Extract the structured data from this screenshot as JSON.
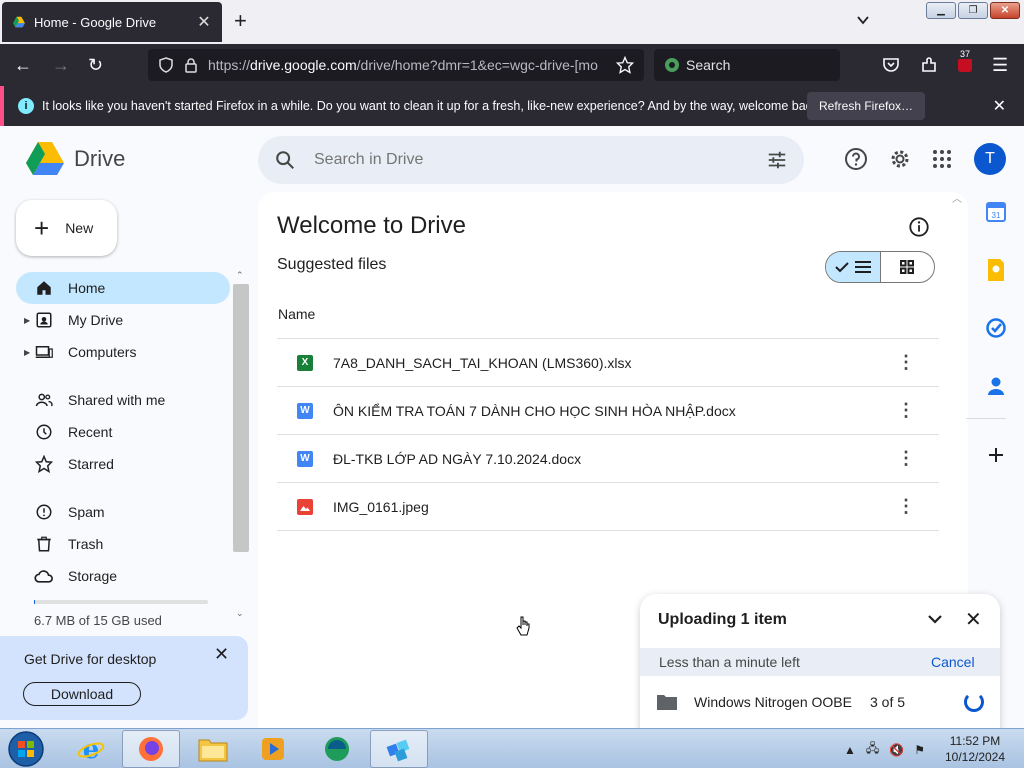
{
  "browser": {
    "tab_title": "Home - Google Drive",
    "url_host": "drive.google.com",
    "url_prefix": "https://",
    "url_path": "/drive/home?dmr=1&ec=wgc-drive-[mo",
    "search_placeholder": "Search",
    "extension_badge": "37",
    "notice_text": "It looks like you haven't started Firefox in a while. Do you want to clean it up for a fresh, like-new experience? And by the way, welcome back!",
    "refresh_label": "Refresh Firefox…"
  },
  "drive": {
    "app_name": "Drive",
    "search_placeholder": "Search in Drive",
    "avatar_letter": "T",
    "new_label": "New",
    "nav": [
      {
        "label": "Home",
        "icon": "home-icon"
      },
      {
        "label": "My Drive",
        "icon": "my-drive-icon"
      },
      {
        "label": "Computers",
        "icon": "computers-icon"
      },
      {
        "label": "Shared with me",
        "icon": "shared-icon"
      },
      {
        "label": "Recent",
        "icon": "recent-icon"
      },
      {
        "label": "Starred",
        "icon": "star-icon"
      },
      {
        "label": "Spam",
        "icon": "spam-icon"
      },
      {
        "label": "Trash",
        "icon": "trash-icon"
      },
      {
        "label": "Storage",
        "icon": "cloud-icon"
      }
    ],
    "storage_used_text": "6.7 MB of 15 GB used",
    "storage_fraction": 0.0005,
    "promo": {
      "title": "Get Drive for desktop",
      "button": "Download"
    },
    "main_title": "Welcome to Drive",
    "suggested_label": "Suggested files",
    "column_name": "Name",
    "files": [
      {
        "name": "7A8_DANH_SACH_TAI_KHOAN (LMS360).xlsx",
        "type": "sheets",
        "icon_letter": "X",
        "color": "#188038"
      },
      {
        "name": "ÔN KIỂM TRA TOÁN 7 DÀNH CHO HỌC SINH HÒA NHẬP.docx",
        "type": "docs",
        "icon_letter": "W",
        "color": "#4285f4"
      },
      {
        "name": "ĐL-TKB LỚP AD NGÀY 7.10.2024.docx",
        "type": "docs",
        "icon_letter": "W",
        "color": "#4285f4"
      },
      {
        "name": "IMG_0161.jpeg",
        "type": "image",
        "icon_letter": "",
        "color": "#ea4335"
      }
    ],
    "upload": {
      "title": "Uploading 1 item",
      "status": "Less than a minute left",
      "cancel": "Cancel",
      "item_name": "Windows Nitrogen OOBE",
      "item_count": "3 of 5"
    }
  },
  "taskbar": {
    "time": "11:52 PM",
    "date": "10/12/2024"
  }
}
